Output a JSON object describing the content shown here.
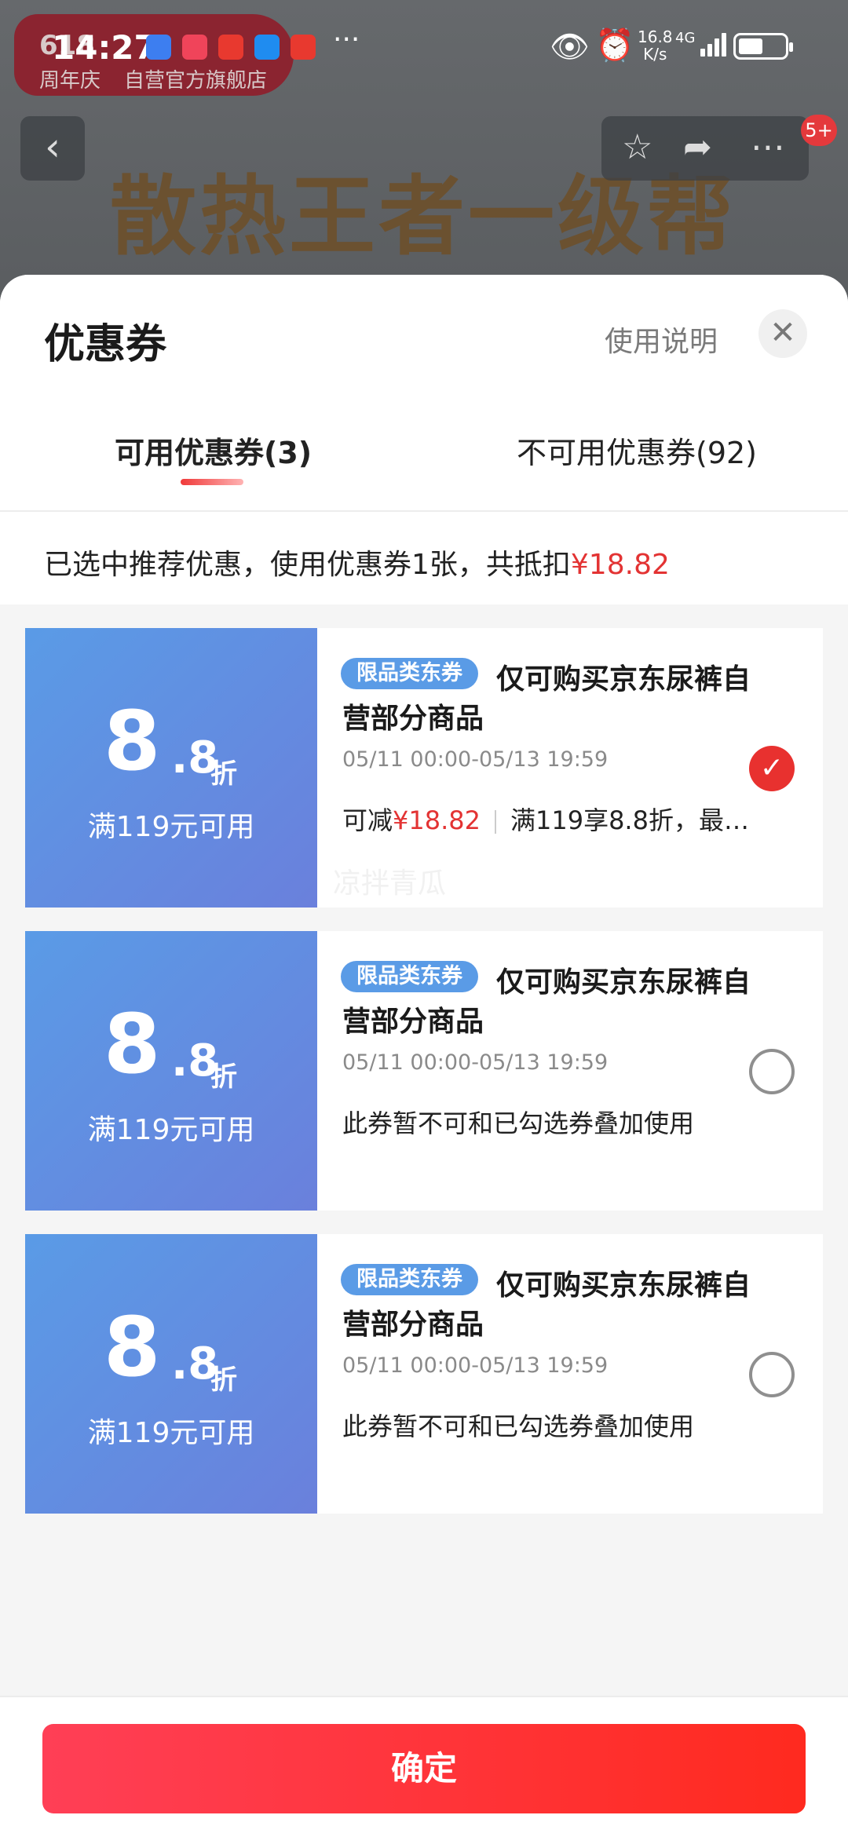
{
  "status_bar": {
    "time": "14:27",
    "more": "···",
    "net_speed": "16.8",
    "net_unit": "K/s",
    "network": "4G"
  },
  "background": {
    "store_badge_line1": "618",
    "store_badge_line2": "周年庆",
    "store_badge_line3": "自营官方旗舰店",
    "hero_text": "散热王者一级帮",
    "back_icon": "chevron-left-icon",
    "actions": [
      "star-icon",
      "share-icon",
      "more-icon"
    ],
    "notification_count": "5+"
  },
  "sheet": {
    "title": "优惠券",
    "help_link": "使用说明",
    "close_icon": "close-icon",
    "tabs": [
      {
        "label": "可用优惠券(3)",
        "active": true
      },
      {
        "label": "不可用优惠券(92)",
        "active": false
      }
    ],
    "summary_prefix": "已选中推荐优惠，使用优惠券1张，共抵扣",
    "summary_amount": "¥18.82"
  },
  "coupons": [
    {
      "discount_int": "8",
      "discount_dec": ".8",
      "discount_unit": "折",
      "condition": "满119元可用",
      "tag": "限品类东券",
      "title_line1": "仅可购买京东尿裤自",
      "title_line2": "营部分商品",
      "date": "05/11 00:00-05/13 19:59",
      "save_label": "可减",
      "save_amount": "¥18.82",
      "rule": "满119享8.8折，最…",
      "watermark": "凉拌青瓜",
      "selected": true
    },
    {
      "discount_int": "8",
      "discount_dec": ".8",
      "discount_unit": "折",
      "condition": "满119元可用",
      "tag": "限品类东券",
      "title_line1": "仅可购买京东尿裤自",
      "title_line2": "营部分商品",
      "date": "05/11 00:00-05/13 19:59",
      "note": "此券暂不可和已勾选券叠加使用",
      "selected": false
    },
    {
      "discount_int": "8",
      "discount_dec": ".8",
      "discount_unit": "折",
      "condition": "满119元可用",
      "tag": "限品类东券",
      "title_line1": "仅可购买京东尿裤自",
      "title_line2": "营部分商品",
      "date": "05/11 00:00-05/13 19:59",
      "note": "此券暂不可和已勾选券叠加使用",
      "selected": false
    }
  ],
  "footer": {
    "confirm_label": "确定"
  },
  "colors": {
    "accent_red": "#e33333",
    "coupon_blue": "#5a9be6",
    "confirm_gradient_start": "#ff3f56",
    "confirm_gradient_end": "#ff2a1f"
  }
}
